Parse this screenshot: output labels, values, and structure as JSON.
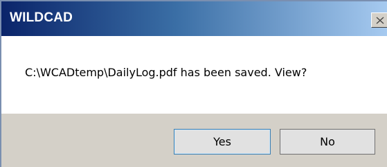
{
  "window": {
    "title": "WILDCAD",
    "close_icon": "close-icon"
  },
  "message": {
    "text": "C:\\WCADtemp\\DailyLog.pdf has been saved. View?"
  },
  "buttons": {
    "yes_label": "Yes",
    "no_label": "No"
  },
  "colors": {
    "title_gradient_start": "#0a246a",
    "title_gradient_end": "#a6caf0",
    "button_panel": "#d4d0c8",
    "default_button_border": "#3c7fb1"
  }
}
